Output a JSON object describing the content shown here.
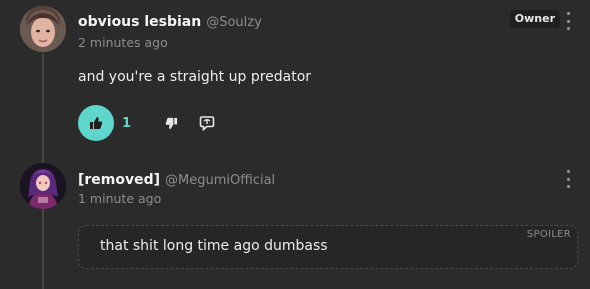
{
  "comments": [
    {
      "author": "obvious lesbian",
      "handle": "@Soulzy",
      "timestamp": "2 minutes ago",
      "badge": "Owner",
      "text": "and you're a straight up predator",
      "like_count": "1",
      "liked": true
    },
    {
      "author": "[removed]",
      "handle": "@MegumiOfficial",
      "timestamp": "1 minute ago",
      "spoiler_label": "SPOILER",
      "text": "that shit long time ago dumbass"
    }
  ],
  "colors": {
    "background": "#2b2b2b",
    "accent": "#5fd6cc",
    "muted_text": "#8c8c8c",
    "thread_line": "#474747"
  },
  "icons": {
    "like": "thumbs-up-icon",
    "dislike": "thumbs-down-icon",
    "reply": "reply-bubble-icon",
    "menu": "more-vertical-icon"
  }
}
